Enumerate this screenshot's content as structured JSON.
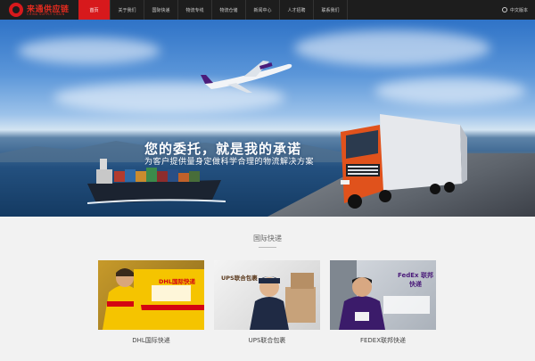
{
  "brand": {
    "name": "来通供应链",
    "sub": "CHINA SUPPLY CHAIN"
  },
  "nav": {
    "items": [
      {
        "label": "首页",
        "active": true
      },
      {
        "label": "关于我们",
        "active": false
      },
      {
        "label": "国际快递",
        "active": false
      },
      {
        "label": "物流专线",
        "active": false
      },
      {
        "label": "物流仓储",
        "active": false
      },
      {
        "label": "新闻中心",
        "active": false
      },
      {
        "label": "人才招聘",
        "active": false
      },
      {
        "label": "联系我们",
        "active": false
      }
    ],
    "language": "中文版本"
  },
  "banner": {
    "headline": "您的委托，就是我的承诺",
    "subline": "为客户提供量身定做科学合理的物流解决方案",
    "slides": 2,
    "active_slide": 1
  },
  "section": {
    "title": "国际快递",
    "cards": [
      {
        "label": "DHL国际快递",
        "image_text": "DHL国际快递",
        "brand_color": "#f5c400"
      },
      {
        "label": "UPS联合包裹",
        "image_text": "UPS联合包裹",
        "brand_color": "#5b3a1e"
      },
      {
        "label": "FEDEX联邦快递",
        "image_text": "FedEx 联邦快递",
        "brand_color": "#4b1c7a"
      }
    ]
  }
}
